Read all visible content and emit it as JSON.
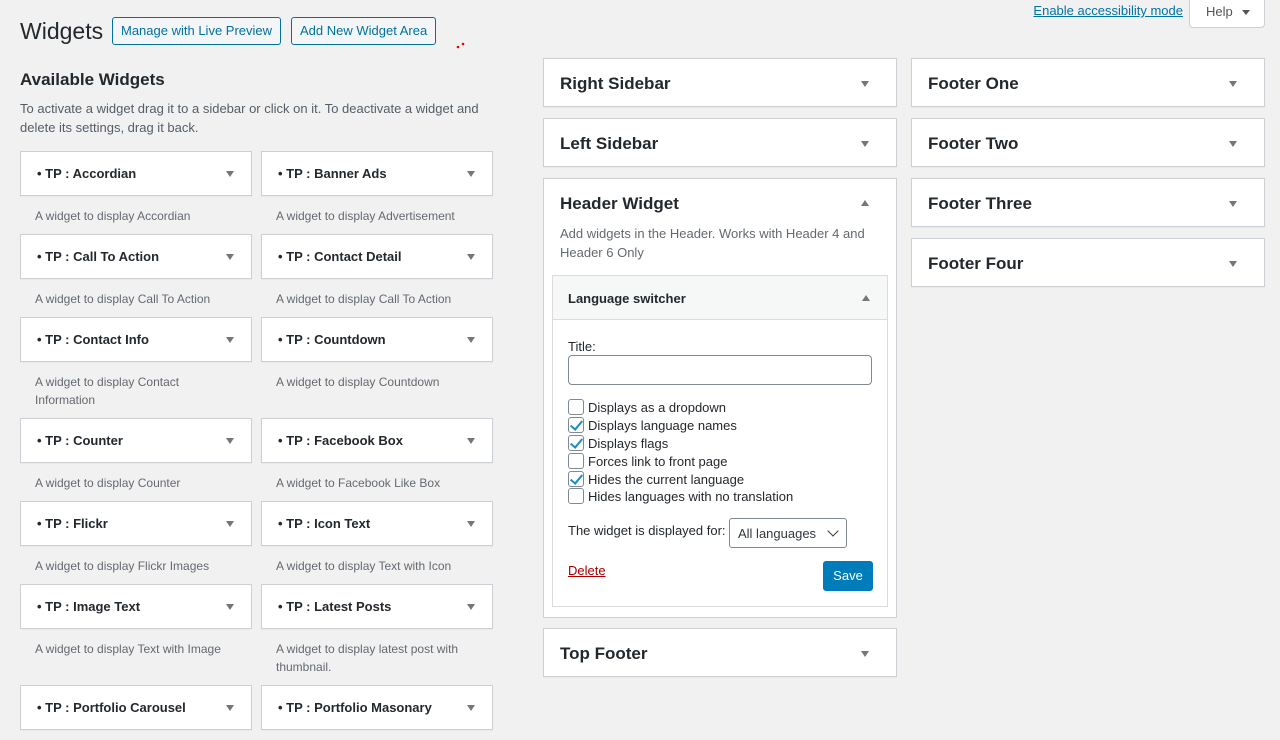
{
  "header": {
    "title": "Widgets",
    "manage_live_preview": "Manage with Live Preview",
    "add_widget_area": "Add New Widget Area",
    "accessibility_link": "Enable accessibility mode",
    "help": "Help"
  },
  "available": {
    "title": "Available Widgets",
    "description": "To activate a widget drag it to a sidebar or click on it. To deactivate a widget and delete its settings, drag it back.",
    "widgets": [
      {
        "name": "• TP : Accordian",
        "desc": "A widget to display Accordian"
      },
      {
        "name": "• TP : Banner Ads",
        "desc": "A widget to display Advertisement"
      },
      {
        "name": "• TP : Call To Action",
        "desc": "A widget to display Call To Action"
      },
      {
        "name": "• TP : Contact Detail",
        "desc": "A widget to display Call To Action"
      },
      {
        "name": "• TP : Contact Info",
        "desc": "A widget to display Contact Information"
      },
      {
        "name": "• TP : Countdown",
        "desc": "A widget to display Countdown"
      },
      {
        "name": "• TP : Counter",
        "desc": "A widget to display Counter"
      },
      {
        "name": "• TP : Facebook Box",
        "desc": "A widget to Facebook Like Box"
      },
      {
        "name": "• TP : Flickr",
        "desc": "A widget to display Flickr Images"
      },
      {
        "name": "• TP : Icon Text",
        "desc": "A widget to display Text with Icon"
      },
      {
        "name": "• TP : Image Text",
        "desc": "A widget to display Text with Image"
      },
      {
        "name": "• TP : Latest Posts",
        "desc": "A widget to display latest post with thumbnail."
      },
      {
        "name": "• TP : Portfolio Carousel",
        "desc": ""
      },
      {
        "name": "• TP : Portfolio Masonary",
        "desc": ""
      }
    ]
  },
  "sidebars": {
    "right_sidebar": "Right Sidebar",
    "left_sidebar": "Left Sidebar",
    "top_footer": "Top Footer",
    "footer_one": "Footer One",
    "footer_two": "Footer Two",
    "footer_three": "Footer Three",
    "footer_four": "Footer Four"
  },
  "header_widget": {
    "name": "Header Widget",
    "description": "Add widgets in the Header. Works with Header 4 and Header 6 Only",
    "language_switcher": {
      "title": "Language switcher",
      "title_label": "Title:",
      "title_value": "",
      "options": [
        {
          "label": "Displays as a dropdown",
          "checked": false
        },
        {
          "label": "Displays language names",
          "checked": true
        },
        {
          "label": "Displays flags",
          "checked": true
        },
        {
          "label": "Forces link to front page",
          "checked": false
        },
        {
          "label": "Hides the current language",
          "checked": true
        },
        {
          "label": "Hides languages with no translation",
          "checked": false
        }
      ],
      "displayed_for_label": "The widget is displayed for:",
      "displayed_for_value": "All languages",
      "delete": "Delete",
      "save": "Save"
    }
  },
  "colors": {
    "accent": "#0071a1",
    "primary_button": "#007cba",
    "danger": "#aa0000",
    "background": "#f1f1f1"
  }
}
